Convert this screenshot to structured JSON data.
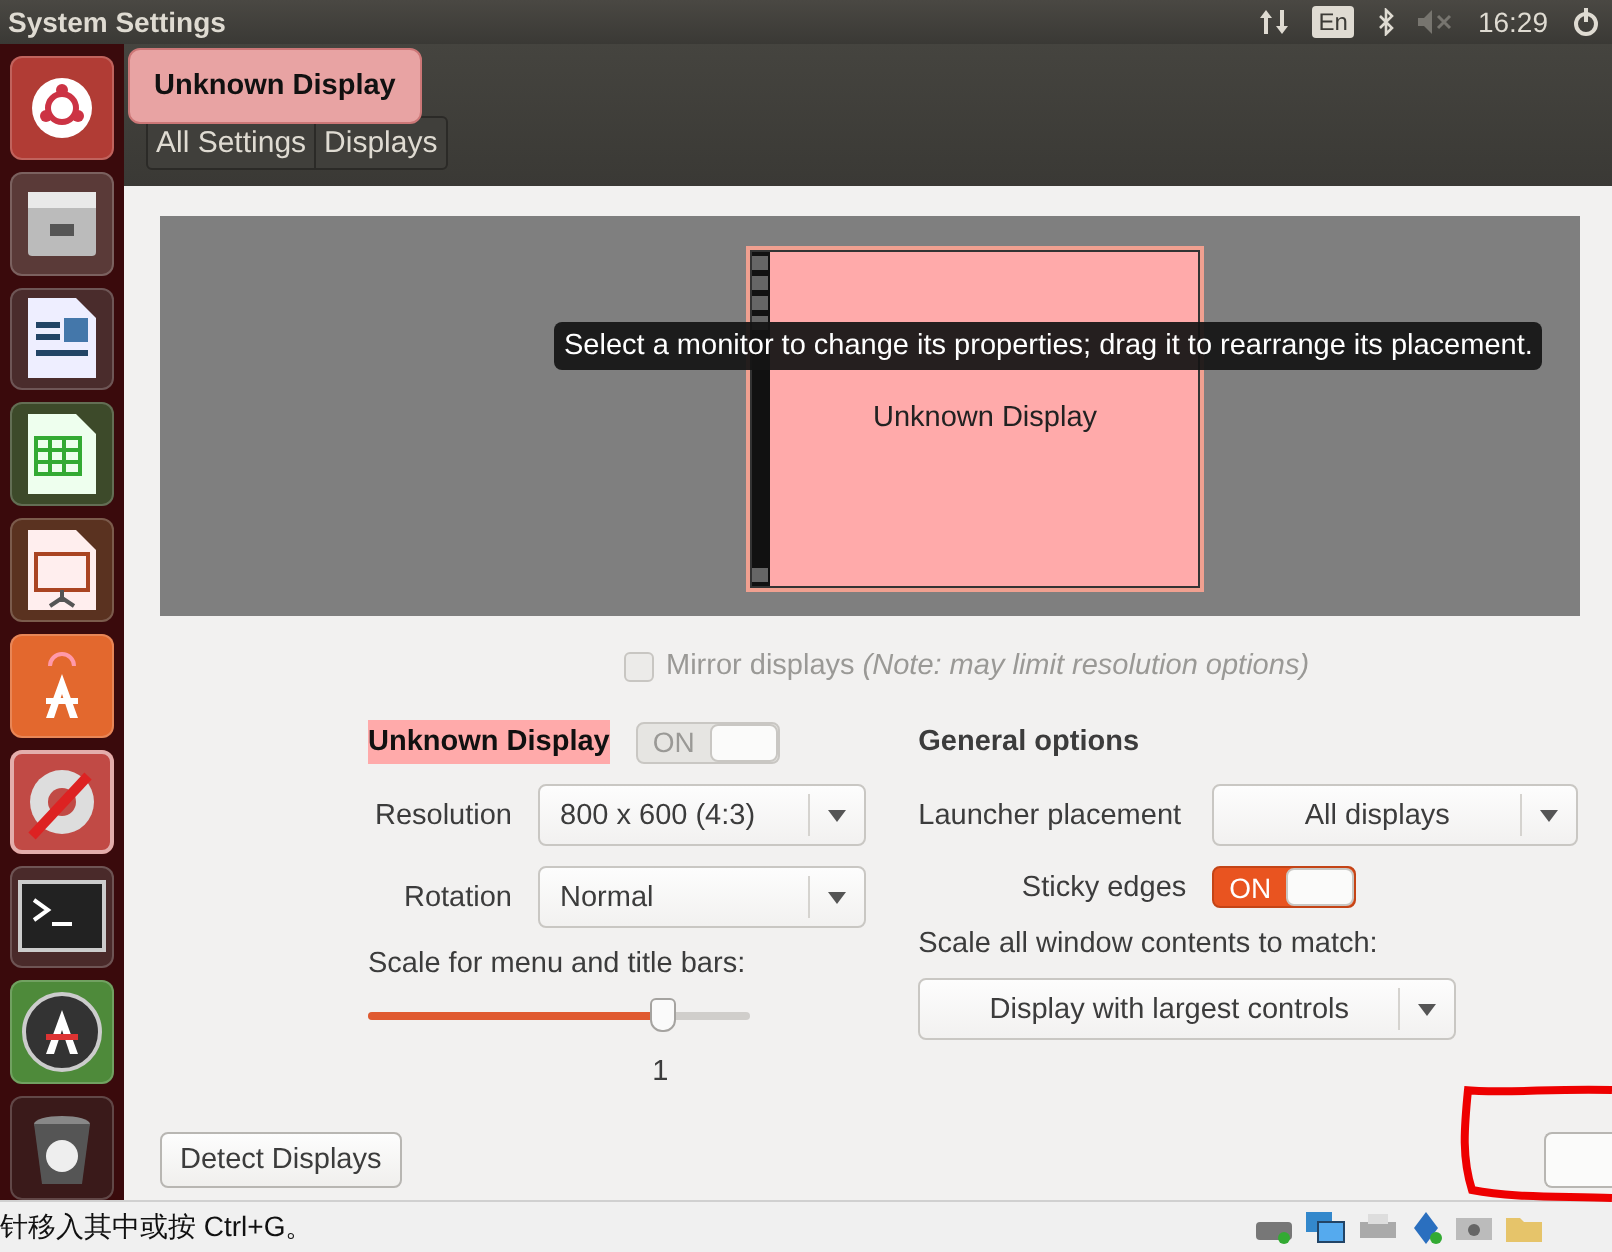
{
  "top_panel": {
    "title": "System Settings",
    "keyboard_layout": "En",
    "time": "16:29"
  },
  "launcher": {
    "items": [
      {
        "kind": "ubuntu",
        "selected": false
      },
      {
        "kind": "files",
        "selected": false
      },
      {
        "kind": "writer",
        "selected": false
      },
      {
        "kind": "calc",
        "selected": false
      },
      {
        "kind": "impress",
        "selected": false
      },
      {
        "kind": "store",
        "selected": false
      },
      {
        "kind": "settings",
        "selected": true
      },
      {
        "kind": "terminal",
        "selected": false
      },
      {
        "kind": "updater",
        "selected": false
      },
      {
        "kind": "trash",
        "selected": false
      }
    ]
  },
  "popup": {
    "text": "Unknown Display"
  },
  "breadcrumbs": [
    "All Settings",
    "Displays"
  ],
  "arrangement": {
    "monitor_label": "Unknown Display",
    "tooltip": "Select a monitor to change its properties; drag it to rearrange its placement."
  },
  "mirror": {
    "label": "Mirror displays *(Note: may limit resolution options)*",
    "checked": false,
    "disabled": true
  },
  "display": {
    "name": "Unknown Display",
    "switch": {
      "label": "ON",
      "on": true,
      "disabled": true
    },
    "resolution": {
      "label": "Resolution",
      "value": "800 x 600 (4:3)"
    },
    "rotation": {
      "label": "Rotation",
      "value": "Normal"
    },
    "scale": {
      "label": "Scale for menu and title bars:",
      "level": 0.77,
      "reading": "1"
    }
  },
  "general": {
    "title": "General options",
    "launcher_placement": {
      "label": "Launcher placement",
      "value": "All displays"
    },
    "sticky_edges": {
      "label": "Sticky edges",
      "switch": {
        "label": "ON",
        "on": true,
        "disabled": false
      }
    },
    "scale_all": {
      "label": "Scale all window contents to match:",
      "value": "Display with largest controls"
    }
  },
  "detect_button": "Detect Displays",
  "status_bar": {
    "hint": "针移入其中或按 Ctrl+G。"
  }
}
